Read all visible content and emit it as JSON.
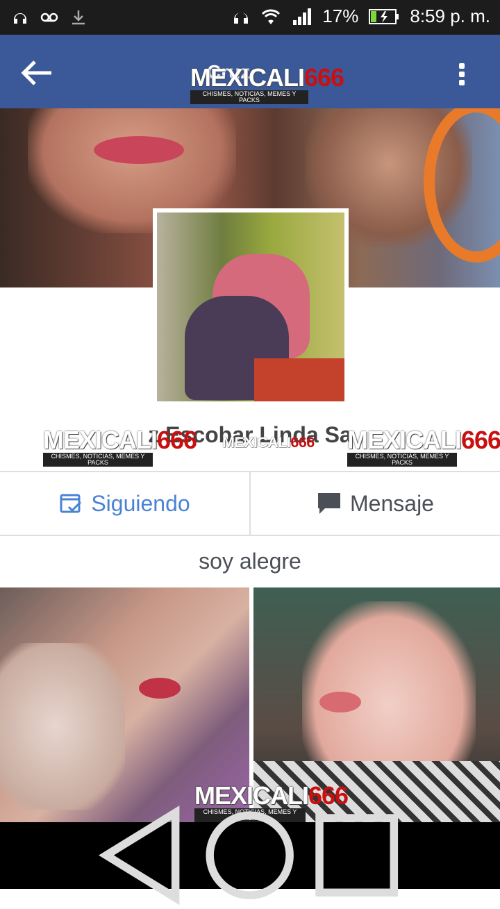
{
  "status_bar": {
    "battery": "17%",
    "time": "8:59 p. m.",
    "icons": [
      "headset-icon",
      "voicemail-icon",
      "download-icon",
      "headphones-icon",
      "wifi-icon",
      "signal-icon",
      "battery-icon"
    ]
  },
  "app_bar": {
    "title": "Cruz",
    "back_icon": "arrow-back-icon",
    "menu_icon": "more-vert-icon",
    "background": "#3b5998"
  },
  "watermark": {
    "brand_a": "MEXICALI",
    "brand_b": "666",
    "tagline": "CHISMES, NOTICIAS, MEMES Y PACKS"
  },
  "profile": {
    "name": "z Escobar Linda Sa"
  },
  "actions": {
    "follow_label": "Siguiendo",
    "message_label": "Mensaje"
  },
  "bio": "soy alegre",
  "colors": {
    "accent": "#4a83d4",
    "divider": "#dcdee3"
  }
}
